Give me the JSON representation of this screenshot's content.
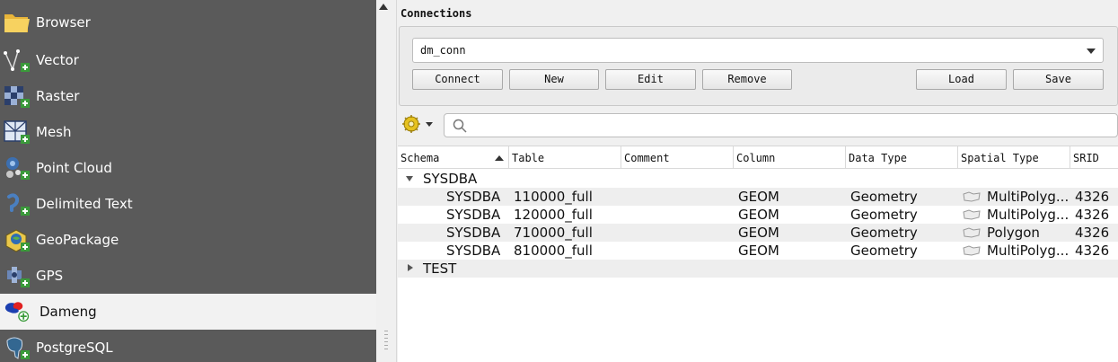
{
  "sidebar": {
    "items": [
      {
        "label": "Browser",
        "icon": "folder-icon"
      },
      {
        "label": "Vector",
        "icon": "vector-add-icon"
      },
      {
        "label": "Raster",
        "icon": "raster-add-icon"
      },
      {
        "label": "Mesh",
        "icon": "mesh-add-icon"
      },
      {
        "label": "Point Cloud",
        "icon": "point-cloud-add-icon"
      },
      {
        "label": "Delimited Text",
        "icon": "delimited-text-add-icon"
      },
      {
        "label": "GeoPackage",
        "icon": "geopackage-add-icon"
      },
      {
        "label": "GPS",
        "icon": "gps-add-icon"
      },
      {
        "label": "Dameng",
        "icon": "dameng-add-icon"
      },
      {
        "label": "PostgreSQL",
        "icon": "postgresql-add-icon"
      }
    ],
    "selected": "Dameng"
  },
  "connections": {
    "title": "Connections",
    "selected_connection": "dm_conn",
    "buttons": {
      "connect": "Connect",
      "new": "New",
      "edit": "Edit",
      "remove": "Remove",
      "load": "Load",
      "save": "Save"
    }
  },
  "search": {
    "placeholder": ""
  },
  "table": {
    "columns": [
      "Schema",
      "Table",
      "Comment",
      "Column",
      "Data Type",
      "Spatial Type",
      "SRID"
    ],
    "groups": [
      {
        "name": "SYSDBA",
        "expanded": true,
        "rows": [
          {
            "schema": "SYSDBA",
            "table": "110000_full",
            "comment": "",
            "column": "GEOM",
            "data_type": "Geometry",
            "spatial_type": "MultiPolyg...",
            "srid": "4326"
          },
          {
            "schema": "SYSDBA",
            "table": "120000_full",
            "comment": "",
            "column": "GEOM",
            "data_type": "Geometry",
            "spatial_type": "MultiPolyg...",
            "srid": "4326"
          },
          {
            "schema": "SYSDBA",
            "table": "710000_full",
            "comment": "",
            "column": "GEOM",
            "data_type": "Geometry",
            "spatial_type": "Polygon",
            "srid": "4326"
          },
          {
            "schema": "SYSDBA",
            "table": "810000_full",
            "comment": "",
            "column": "GEOM",
            "data_type": "Geometry",
            "spatial_type": "MultiPolyg...",
            "srid": "4326"
          }
        ]
      },
      {
        "name": "TEST",
        "expanded": false,
        "rows": []
      }
    ]
  },
  "colors": {
    "sidebar_bg": "#5a5a5a",
    "selected_bg": "#f2f2f2",
    "row_alt": "#eeeeee"
  }
}
